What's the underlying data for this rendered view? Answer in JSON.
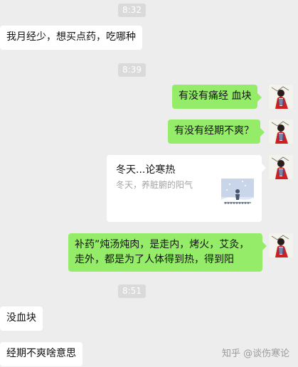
{
  "timestamps": [
    "8:32",
    "8:39",
    "8:51"
  ],
  "messages": {
    "m1": "我月经少，想买点药，吃哪种",
    "m2": "有没有痛经  血块",
    "m3": "有没有经期不爽？",
    "m5_line1": "补药”炖汤炖肉，是走内，烤火，艾灸，",
    "m5_line2": "走外，都是为了人体得到热，得到阳",
    "m6": "没血块",
    "m7": "经期不爽啥意思"
  },
  "card": {
    "title": "冬天...论寒热",
    "desc": "冬天，养脏腑的阳气"
  },
  "watermark": {
    "text": "知乎 @谈伤寒论"
  },
  "colors": {
    "background": "#ededed",
    "incoming_bubble": "#ffffff",
    "outgoing_bubble": "#95ec69",
    "timestamp_bg": "#dadada"
  },
  "icons": {
    "avatar": "avatar-red-figure-icon",
    "card_thumbnail": "snow-scene-thumbnail"
  }
}
